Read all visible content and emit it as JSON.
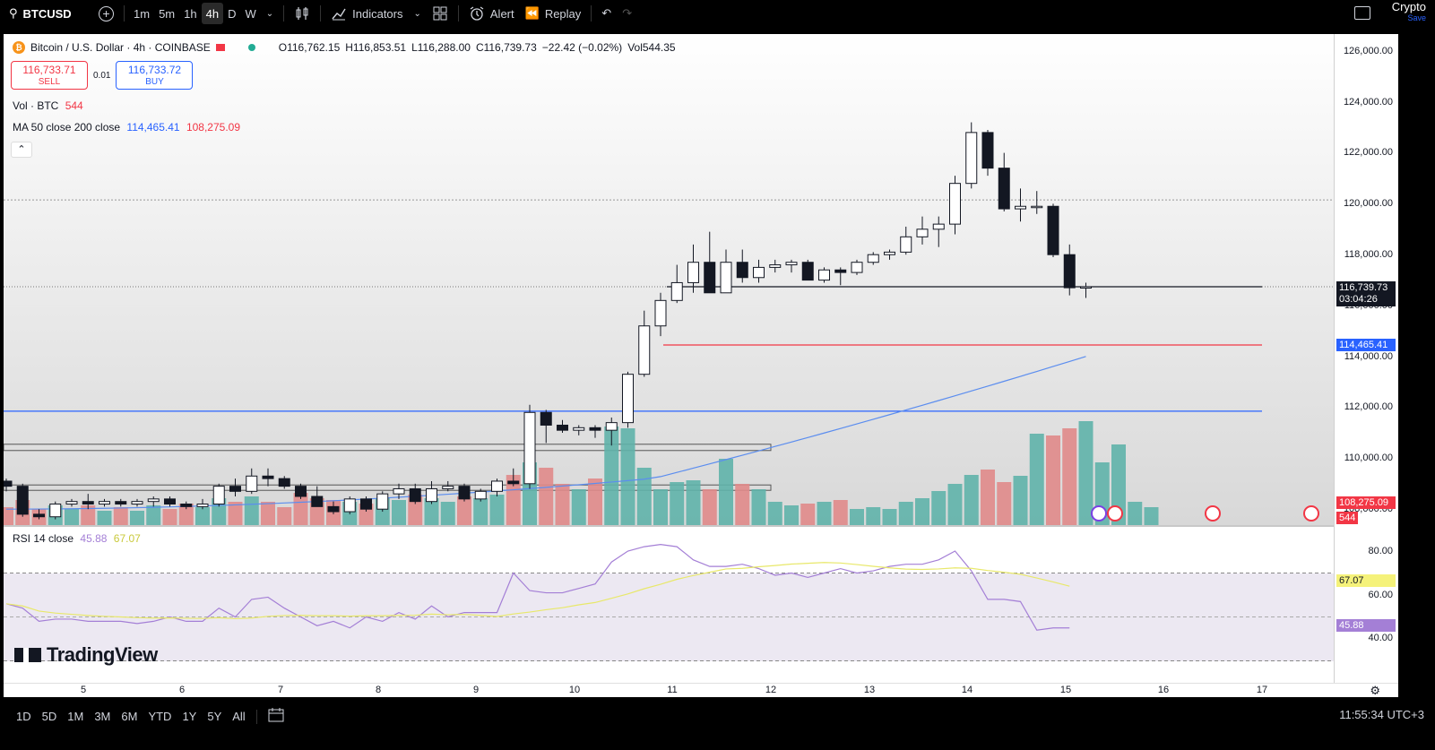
{
  "toolbar": {
    "symbol": "BTCUSD",
    "timeframes": [
      "1m",
      "5m",
      "1h",
      "4h",
      "D",
      "W"
    ],
    "active_timeframe": "4h",
    "indicators_label": "Indicators",
    "alert_label": "Alert",
    "replay_label": "Replay",
    "crypto_label": "Crypto",
    "save_label": "Save"
  },
  "legend": {
    "title": "Bitcoin / U.S. Dollar · 4h · COINBASE",
    "open": "O116,762.15",
    "high": "H116,853.51",
    "low": "L116,288.00",
    "close": "C116,739.73",
    "change": "−22.42 (−0.02%)",
    "volume": "Vol544.35"
  },
  "trade": {
    "sell_price": "116,733.71",
    "sell_label": "SELL",
    "spread": "0.01",
    "buy_price": "116,733.72",
    "buy_label": "BUY"
  },
  "volume_legend": {
    "label": "Vol · BTC",
    "value": "544"
  },
  "ma_legend": {
    "label": "MA 50 close 200 close",
    "ma50": "114,465.41",
    "ma200": "108,275.09"
  },
  "rsi_legend": {
    "label": "RSI 14 close",
    "rsi": "45.88",
    "rsi_ma": "67.07"
  },
  "price_axis": [
    "126,000.00",
    "124,000.00",
    "122,000.00",
    "120,000.00",
    "118,000.00",
    "116,000.00",
    "114,000.00",
    "112,000.00",
    "110,000.00",
    "108,000.00"
  ],
  "price_tags": {
    "last": "116,739.73",
    "countdown": "03:04:26",
    "ma50": "114,465.41",
    "ma200": "108,275.09",
    "vol": "544"
  },
  "rsi_axis": [
    "80.00",
    "60.00",
    "40.00"
  ],
  "rsi_tags": {
    "rsi_ma": "67.07",
    "rsi": "45.88"
  },
  "time_axis": [
    "5",
    "6",
    "7",
    "8",
    "9",
    "10",
    "11",
    "12",
    "13",
    "14",
    "15",
    "16",
    "17"
  ],
  "watermark": "TradingView",
  "bottom": {
    "ranges": [
      "1D",
      "5D",
      "1M",
      "3M",
      "6M",
      "YTD",
      "1Y",
      "5Y",
      "All"
    ],
    "clock": "11:55:34 UTC+3"
  },
  "colors": {
    "up_volume": "#5fb3aa",
    "down_volume": "#e08a8a",
    "ma50": "#5b8def",
    "ma200_hline": "#f23645",
    "hline_blue": "#2962ff",
    "rsi": "#a47fd6",
    "rsi_ma": "#e8e86a"
  },
  "chart_data": {
    "type": "candlestick",
    "x_range": [
      "5",
      "17"
    ],
    "y_range": [
      107700,
      126300
    ],
    "candles": [
      [
        109100,
        109200,
        108700,
        108900
      ],
      [
        108900,
        109000,
        107700,
        107800
      ],
      [
        107800,
        108000,
        107600,
        107700
      ],
      [
        107700,
        108300,
        107600,
        108200
      ],
      [
        108200,
        108400,
        108100,
        108300
      ],
      [
        108300,
        108600,
        108000,
        108200
      ],
      [
        108200,
        108400,
        108100,
        108300
      ],
      [
        108300,
        108400,
        108100,
        108200
      ],
      [
        108200,
        108400,
        108100,
        108300
      ],
      [
        108300,
        108500,
        108100,
        108400
      ],
      [
        108400,
        108500,
        108100,
        108200
      ],
      [
        108200,
        108300,
        108000,
        108100
      ],
      [
        108100,
        108400,
        108000,
        108200
      ],
      [
        108200,
        109000,
        108100,
        108900
      ],
      [
        108900,
        109200,
        108500,
        108700
      ],
      [
        108700,
        109600,
        108600,
        109300
      ],
      [
        109300,
        109600,
        108900,
        109200
      ],
      [
        109200,
        109300,
        108800,
        108900
      ],
      [
        108900,
        109000,
        108400,
        108500
      ],
      [
        108500,
        108900,
        108300,
        108100
      ],
      [
        108100,
        108300,
        107800,
        107900
      ],
      [
        107900,
        108500,
        107800,
        108400
      ],
      [
        108400,
        108500,
        107900,
        108000
      ],
      [
        108000,
        108700,
        107900,
        108600
      ],
      [
        108600,
        109000,
        108400,
        108800
      ],
      [
        108800,
        109000,
        108200,
        108300
      ],
      [
        108300,
        109100,
        108200,
        108800
      ],
      [
        108800,
        109100,
        108700,
        108900
      ],
      [
        108900,
        109000,
        108300,
        108400
      ],
      [
        108400,
        108800,
        108300,
        108700
      ],
      [
        108700,
        109200,
        108500,
        109100
      ],
      [
        109100,
        109600,
        108900,
        109000
      ],
      [
        109000,
        112100,
        108800,
        111800
      ],
      [
        111800,
        111900,
        110600,
        111300
      ],
      [
        111300,
        111500,
        111000,
        111100
      ],
      [
        111100,
        111300,
        110900,
        111200
      ],
      [
        111200,
        111300,
        110800,
        111100
      ],
      [
        111100,
        111600,
        110500,
        111400
      ],
      [
        111400,
        113400,
        111200,
        113300
      ],
      [
        113300,
        115800,
        113200,
        115200
      ],
      [
        115200,
        116500,
        114800,
        116200
      ],
      [
        116200,
        117600,
        116100,
        116900
      ],
      [
        116900,
        118400,
        116500,
        117700
      ],
      [
        117700,
        118900,
        116700,
        116500
      ],
      [
        116500,
        118200,
        116500,
        117700
      ],
      [
        117700,
        118200,
        116900,
        117100
      ],
      [
        117100,
        117800,
        116900,
        117500
      ],
      [
        117500,
        117800,
        117300,
        117600
      ],
      [
        117600,
        117800,
        117300,
        117700
      ],
      [
        117700,
        117800,
        117000,
        117000
      ],
      [
        117000,
        117500,
        116900,
        117400
      ],
      [
        117400,
        117500,
        116800,
        117300
      ],
      [
        117300,
        117800,
        117200,
        117700
      ],
      [
        117700,
        118100,
        117600,
        118000
      ],
      [
        118000,
        118200,
        117800,
        118100
      ],
      [
        118100,
        119100,
        118000,
        118700
      ],
      [
        118700,
        119500,
        118400,
        119000
      ],
      [
        119000,
        119500,
        118300,
        119200
      ],
      [
        119200,
        121100,
        118800,
        120800
      ],
      [
        120800,
        123200,
        120600,
        122800
      ],
      [
        122800,
        122900,
        121100,
        121400
      ],
      [
        121400,
        122000,
        119700,
        119800
      ],
      [
        119800,
        120600,
        119300,
        119900
      ],
      [
        119900,
        120500,
        119600,
        119900
      ],
      [
        119900,
        120000,
        117900,
        118000
      ],
      [
        118000,
        118400,
        116400,
        116700
      ],
      [
        116700,
        116900,
        116300,
        116740
      ]
    ]
  }
}
